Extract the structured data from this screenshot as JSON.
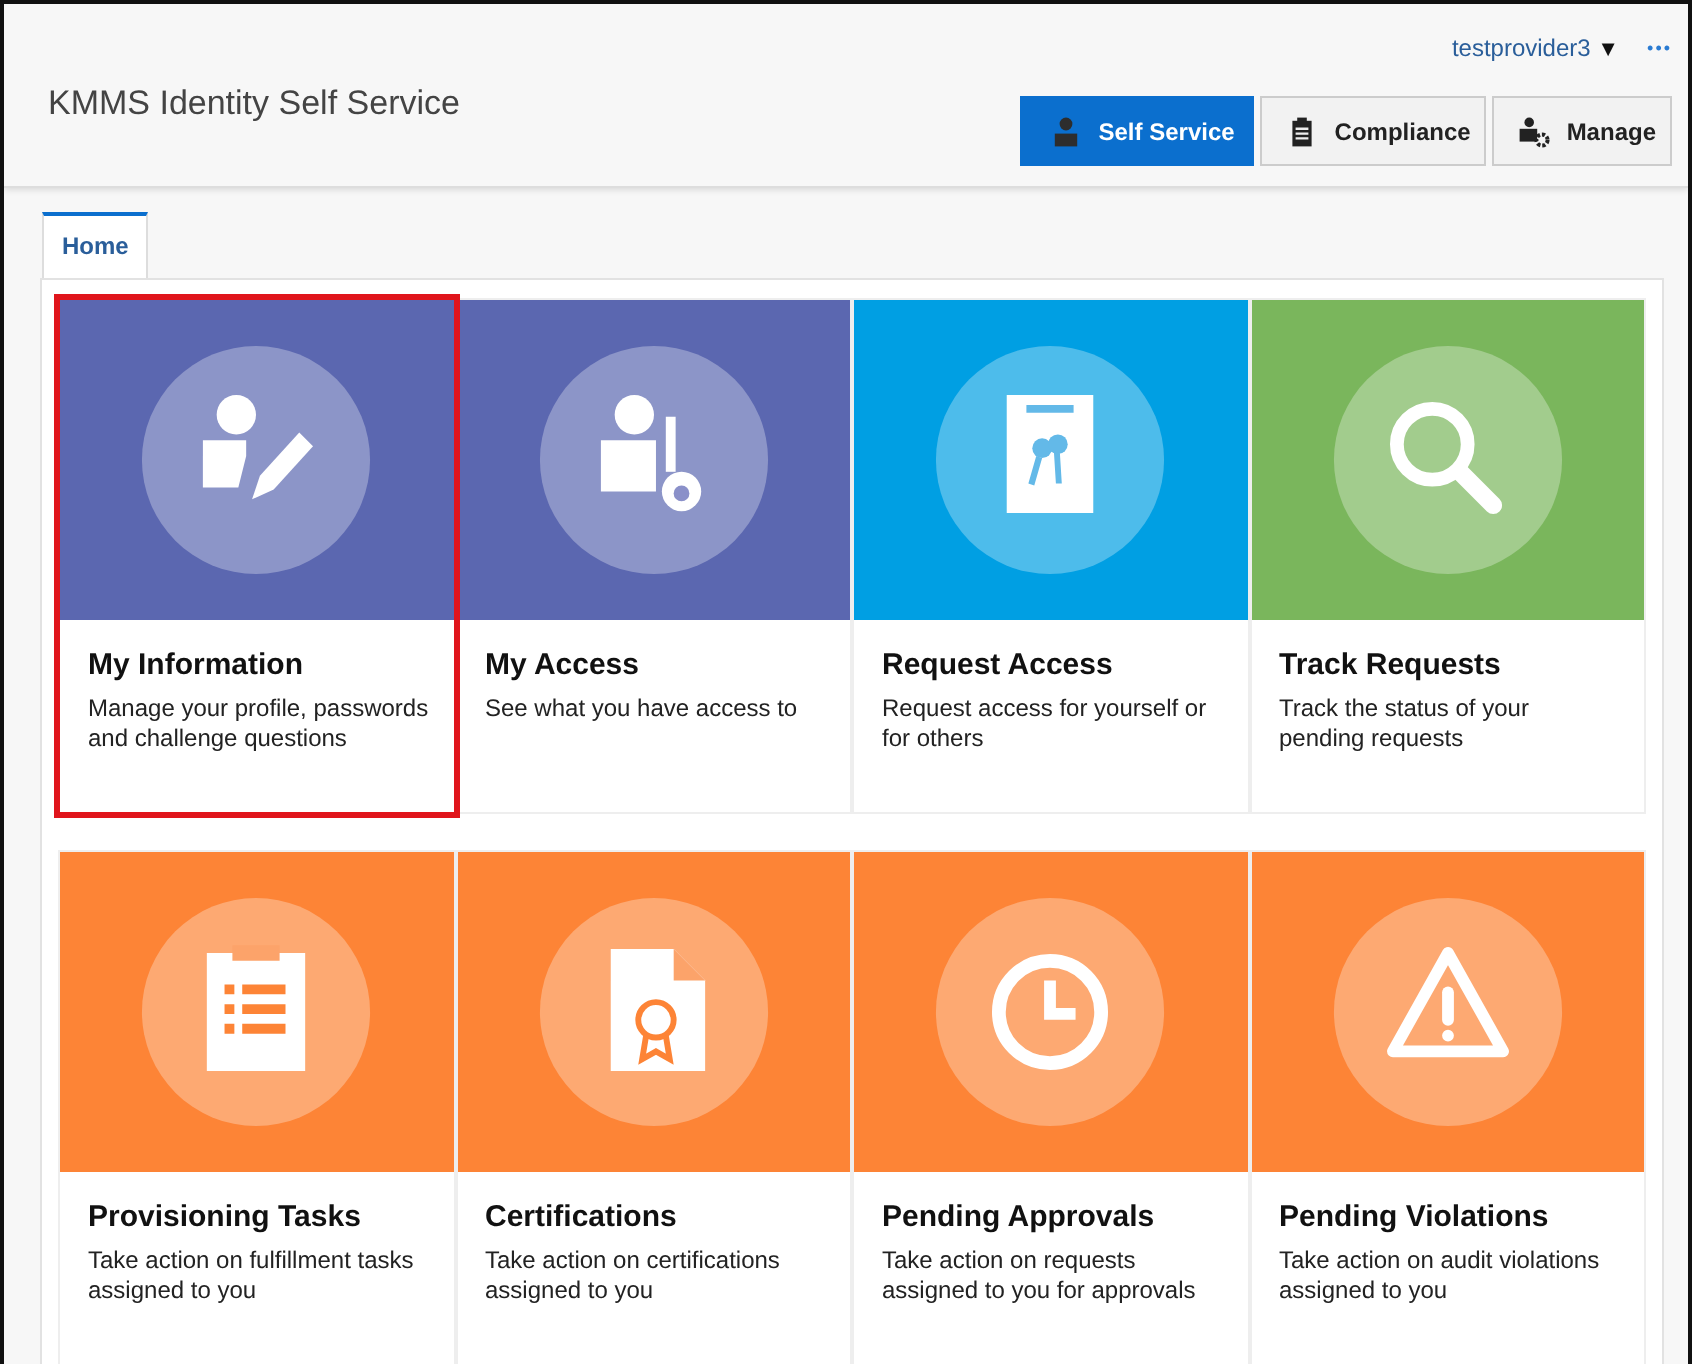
{
  "header": {
    "title": "KMMS Identity Self Service",
    "user": "testprovider3",
    "user_caret": "▼",
    "more": "•••"
  },
  "nav_buttons": [
    {
      "label": "Self Service",
      "selected": true
    },
    {
      "label": "Compliance",
      "selected": false
    },
    {
      "label": "Manage",
      "selected": false
    }
  ],
  "tabs": [
    {
      "label": "Home",
      "selected": true
    }
  ],
  "tiles": [
    {
      "title": "My Information",
      "description": "Manage your profile, passwords and challenge questions",
      "color": "#5b67b0",
      "highlighted": true
    },
    {
      "title": "My Access",
      "description": "See what you have access to",
      "color": "#5b67b0",
      "highlighted": false
    },
    {
      "title": "Request Access",
      "description": "Request access for yourself or for others",
      "color": "#009fe3",
      "highlighted": false
    },
    {
      "title": "Track Requests",
      "description": "Track the status of your pending requests",
      "color": "#7ab65c",
      "highlighted": false
    },
    {
      "title": "Provisioning Tasks",
      "description": "Take action on fulfillment tasks assigned to you",
      "color": "#fd8436",
      "highlighted": false
    },
    {
      "title": "Certifications",
      "description": "Take action on certifications assigned to you",
      "color": "#fd8436",
      "highlighted": false
    },
    {
      "title": "Pending Approvals",
      "description": "Take action on requests assigned to you for approvals",
      "color": "#fd8436",
      "highlighted": false
    },
    {
      "title": "Pending Violations",
      "description": "Take action on audit violations assigned to you",
      "color": "#fd8436",
      "highlighted": false
    }
  ]
}
